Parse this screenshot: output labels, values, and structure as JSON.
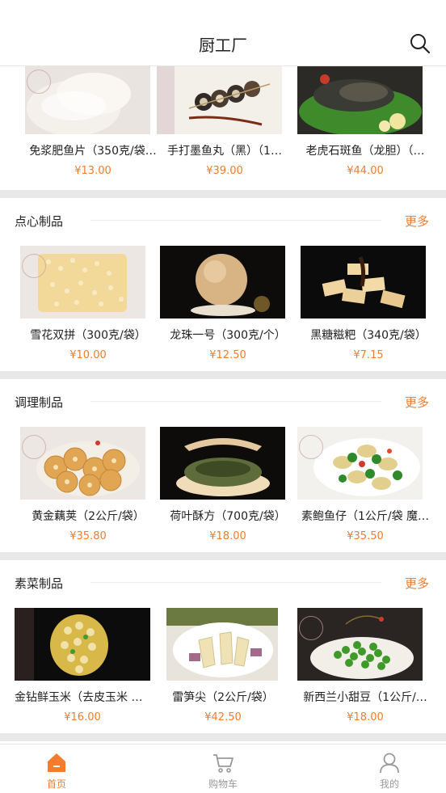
{
  "header": {
    "title": "厨工厂"
  },
  "icons": {
    "search": "search-icon",
    "home": "home-icon",
    "cart": "cart-icon",
    "user": "user-icon"
  },
  "colors": {
    "accent": "#f47c2c",
    "divider": "#e9e9e9",
    "inactive": "#999999"
  },
  "top_row": [
    {
      "name": "免浆肥鱼片（350克/袋…",
      "price": "¥13.00"
    },
    {
      "name": "手打墨鱼丸（黑）（1…",
      "price": "¥39.00"
    },
    {
      "name": "老虎石斑鱼（龙胆）（…",
      "price": "¥44.00"
    }
  ],
  "sections": [
    {
      "title": "点心制品",
      "more": "更多",
      "items": [
        {
          "name": "雪花双拼（300克/袋）",
          "price": "¥10.00"
        },
        {
          "name": "龙珠一号（300克/个）",
          "price": "¥12.50"
        },
        {
          "name": "黑糖糍粑（340克/袋）",
          "price": "¥7.15"
        }
      ]
    },
    {
      "title": "调理制品",
      "more": "更多",
      "items": [
        {
          "name": "黄金藕荚（2公斤/袋）",
          "price": "¥35.80"
        },
        {
          "name": "荷叶酥方（700克/袋）",
          "price": "¥18.00"
        },
        {
          "name": "素鲍鱼仔（1公斤/袋 魔…",
          "price": "¥35.50"
        }
      ]
    },
    {
      "title": "素菜制品",
      "more": "更多",
      "items": [
        {
          "name": "金钻鲜玉米（去皮玉米 …",
          "price": "¥16.00"
        },
        {
          "name": "雷笋尖（2公斤/袋）",
          "price": "¥42.50"
        },
        {
          "name": "新西兰小甜豆（1公斤/…",
          "price": "¥18.00"
        }
      ]
    }
  ],
  "tabbar": [
    {
      "label": "首页",
      "active": true
    },
    {
      "label": "购物车",
      "active": false
    },
    {
      "label": "我的",
      "active": false
    }
  ]
}
